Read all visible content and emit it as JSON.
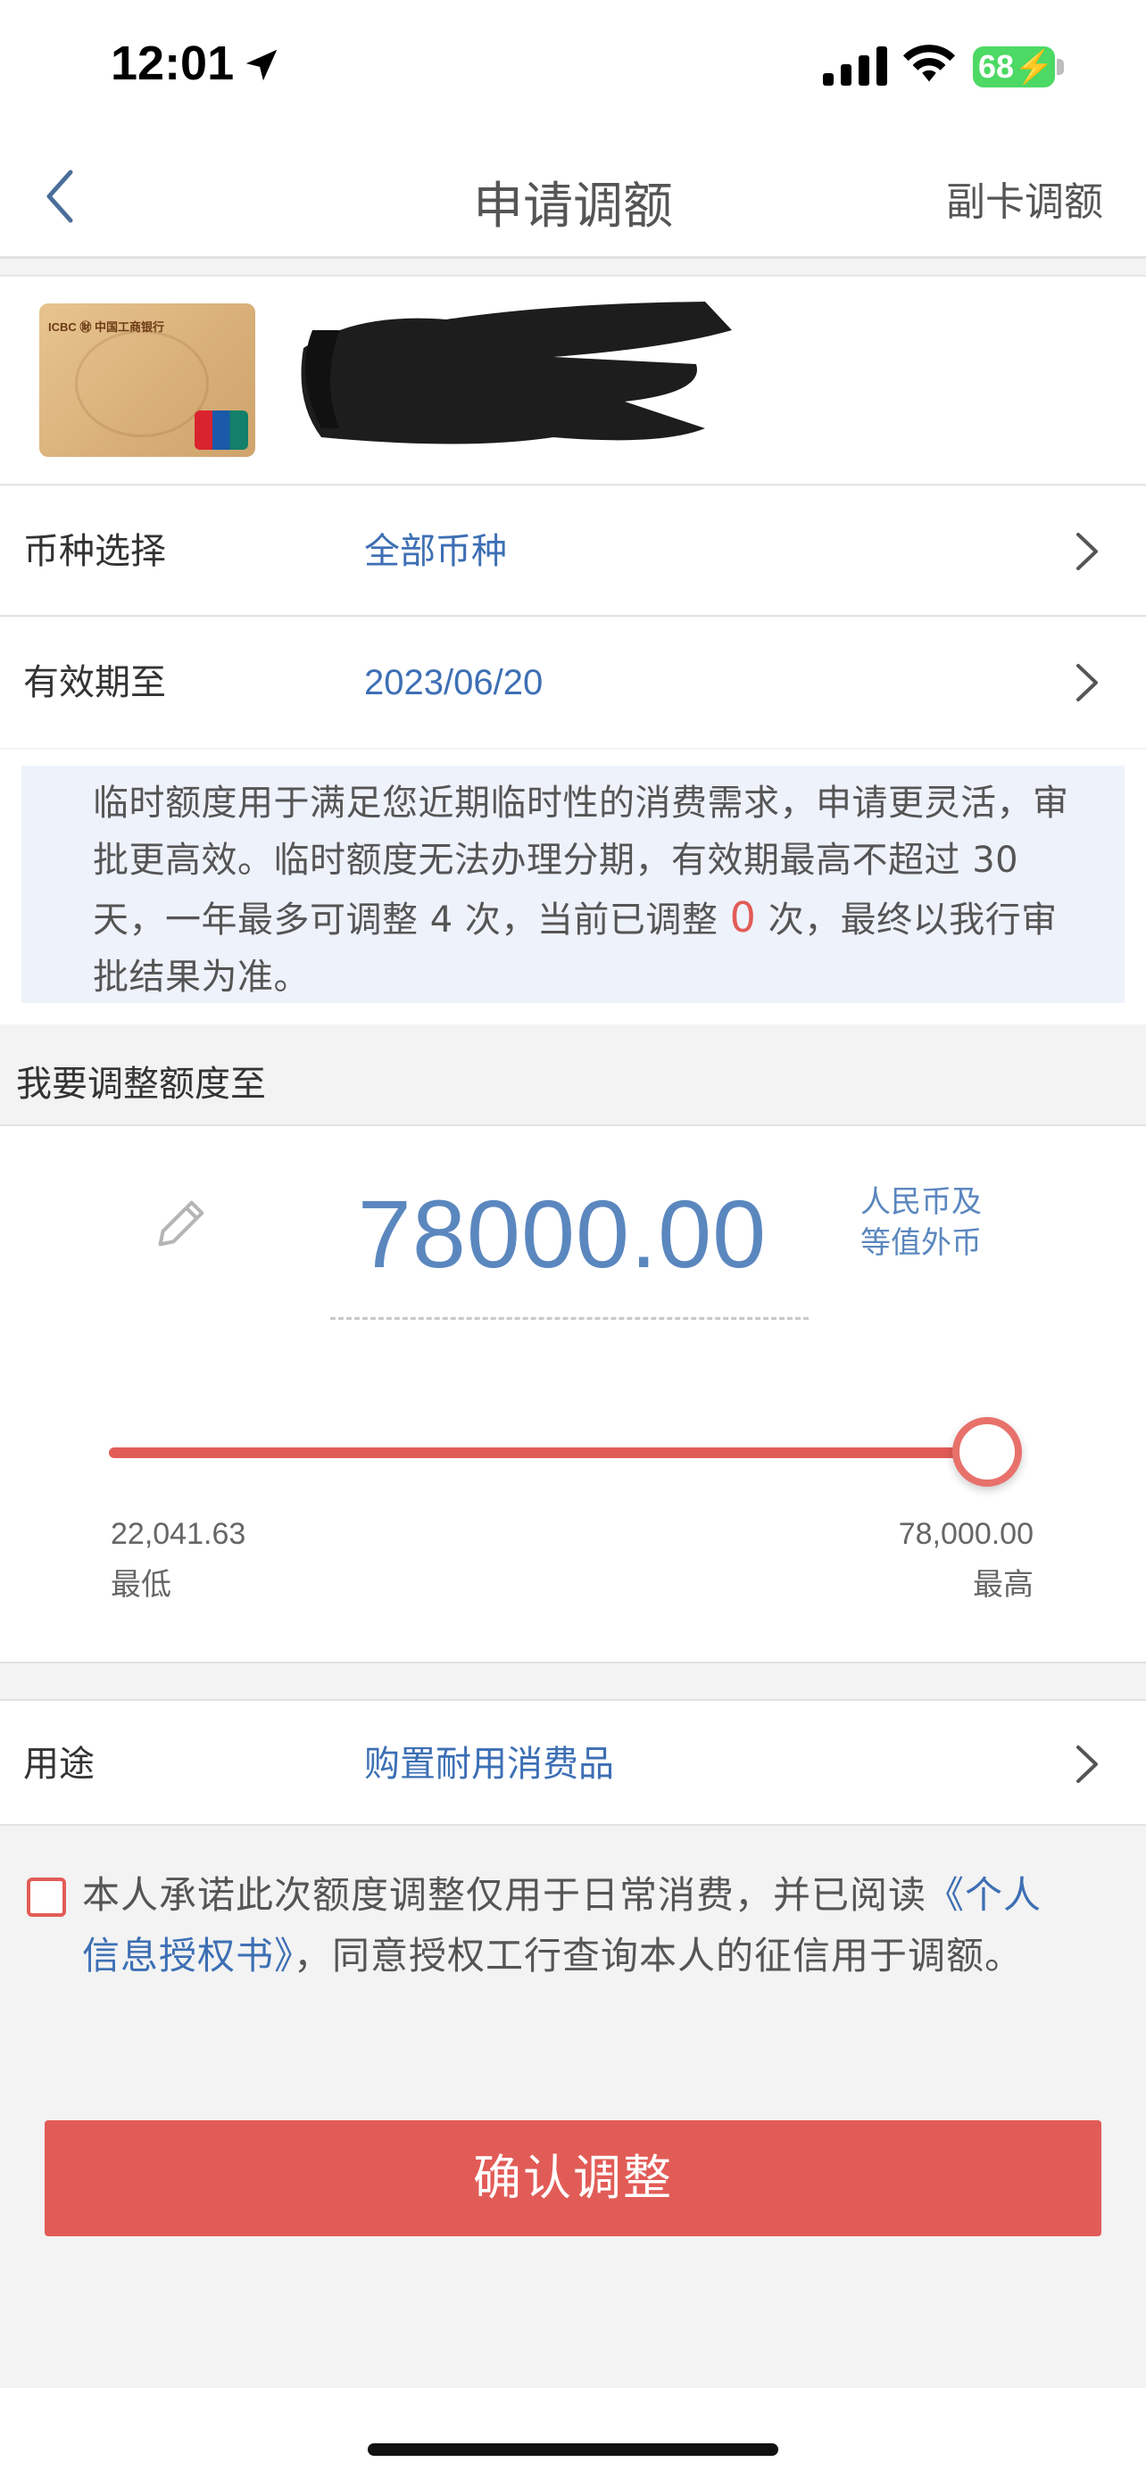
{
  "status_bar": {
    "time": "12:01",
    "battery": "68"
  },
  "nav": {
    "title": "申请调额",
    "right_action": "副卡调额"
  },
  "rows": {
    "currency": {
      "label": "币种选择",
      "value": "全部币种"
    },
    "expiry": {
      "label": "有效期至",
      "value": "2023/06/20"
    }
  },
  "notice": {
    "before": "临时额度用于满足您近期临时性的消费需求，申请更灵活，审批更高效。临时额度无法办理分期，有效期最高不超过 30 天，一年最多可调整 4 次，当前已调整 ",
    "count": "0",
    "after": " 次，最终以我行审批结果为准。"
  },
  "adjust": {
    "section_title": "我要调整额度至",
    "amount": "78000.00",
    "currency_line1": "人民币及",
    "currency_line2": "等值外币",
    "slider": {
      "min": 22041.63,
      "max": 78000.0,
      "value": 78000.0
    },
    "min_value": "22,041.63",
    "min_label": "最低",
    "max_value": "78,000.00",
    "max_label": "最高"
  },
  "purpose": {
    "label": "用途",
    "value": "购置耐用消费品"
  },
  "agreement": {
    "text_before": "本人承诺此次额度调整仅用于日常消费，并已阅读",
    "link": "《个人信息授权书》",
    "text_after": "，同意授权工行查询本人的征信用于调额。",
    "checked": false
  },
  "confirm_label": "确认调整",
  "colors": {
    "accent_red": "#e25c57",
    "link_blue": "#3d6fb4",
    "amount_blue": "#5b87bf"
  }
}
